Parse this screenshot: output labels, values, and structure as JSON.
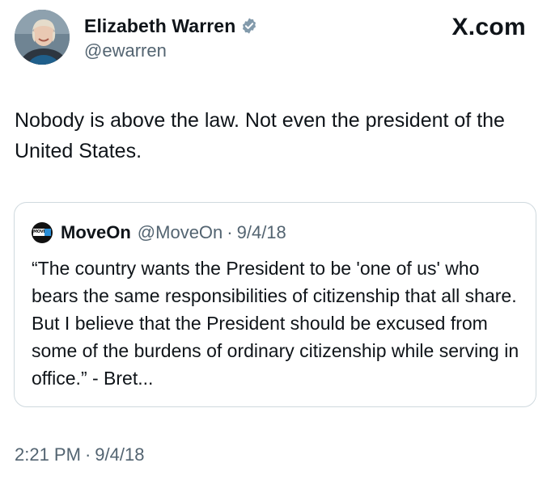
{
  "author": {
    "display_name": "Elizabeth Warren",
    "handle": "@ewarren",
    "avatar_icon": "profile-photo",
    "verified_icon": "verified-badge-icon",
    "verified_color": "#829aab"
  },
  "brand": {
    "label": "X.com"
  },
  "tweet": {
    "text": "Nobody is above the law. Not even the president of the United States."
  },
  "quote": {
    "avatar_icon": "moveon-logo",
    "avatar_text": "MOVE",
    "name": "MoveOn",
    "handle": "@MoveOn",
    "separator": "·",
    "date": "9/4/18",
    "text": "“The country wants the President to be 'one of us' who bears the same responsibilities of citizenship that all share. But I believe that the President should be excused from some of the burdens of ordinary citizenship while serving in office.” - Bret..."
  },
  "timestamp": {
    "time": "2:21 PM",
    "separator": "·",
    "date": "9/4/18"
  },
  "colors": {
    "text_primary": "#0f1419",
    "text_secondary": "#536471",
    "border": "#cfd9de"
  }
}
